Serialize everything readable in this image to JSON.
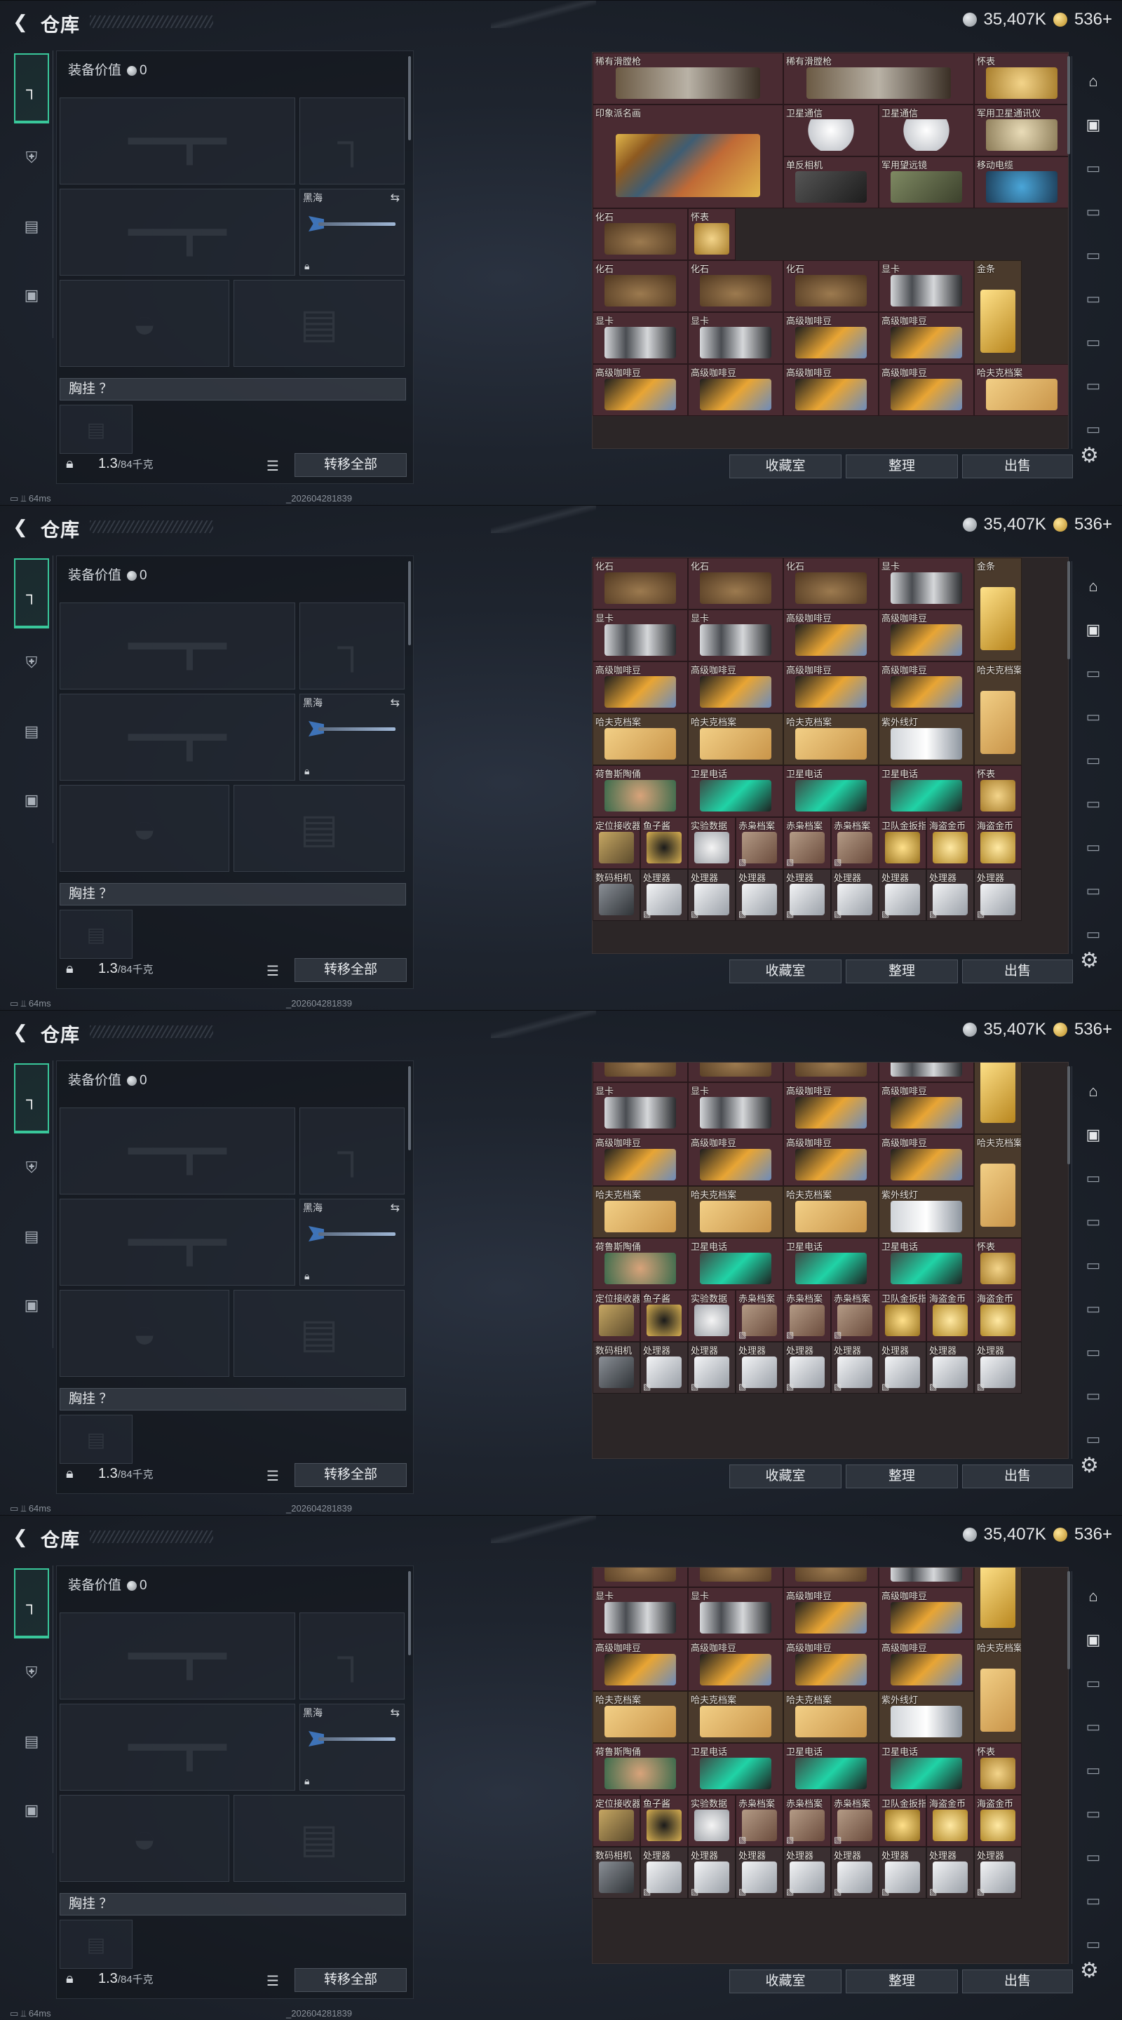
{
  "app": {
    "back_icon": "back-arrow-icon",
    "title": "仓库",
    "currency_silver": "35,407K",
    "currency_gold": "536+"
  },
  "left_tabs": [
    "weapon-icon",
    "helmet-icon",
    "vest-icon",
    "briefcase-icon"
  ],
  "equip": {
    "value_label": "装备价值",
    "value": "0",
    "melee_label": "黑海",
    "chest_label": "胸挂 ？",
    "weight_value": "1.3",
    "weight_max": "/84千克",
    "transfer_all": "转移全部"
  },
  "right_buttons": {
    "collection": "收藏室",
    "organize": "整理",
    "sell": "出售"
  },
  "status": {
    "ping": "64ms",
    "stamp": "_202604281839"
  },
  "right_side_icons": [
    "home-icon",
    "camera-icon",
    "tv-icon",
    "tv-icon",
    "tv-icon",
    "tv-icon",
    "tv-icon",
    "tv-icon",
    "tv-icon"
  ],
  "grid_view1": [
    {
      "c": 0,
      "r": 0,
      "w": 2,
      "h": 1,
      "name": "稀有滑膛枪",
      "art": "musket",
      "tone": "wine"
    },
    {
      "c": 2,
      "r": 0,
      "w": 2,
      "h": 1,
      "name": "稀有滑膛枪",
      "art": "musket",
      "tone": "wine"
    },
    {
      "c": 4,
      "r": 0,
      "w": 1,
      "h": 1,
      "name": "怀表",
      "art": "watch",
      "tone": "wine"
    },
    {
      "c": 0,
      "r": 1,
      "w": 2,
      "h": 2,
      "name": "印象派名画",
      "art": "painting",
      "tone": "wine"
    },
    {
      "c": 2,
      "r": 1,
      "w": 1,
      "h": 1,
      "name": "卫星通信",
      "art": "dish",
      "tone": "wine"
    },
    {
      "c": 3,
      "r": 1,
      "w": 1,
      "h": 1,
      "name": "卫星通信",
      "art": "dish",
      "tone": "wine"
    },
    {
      "c": 4,
      "r": 1,
      "w": 1,
      "h": 1,
      "name": "军用卫星通讯仪",
      "art": "milsat",
      "tone": "wine"
    },
    {
      "c": 2,
      "r": 2,
      "w": 1,
      "h": 1,
      "name": "单反相机",
      "art": "camera",
      "tone": "wine"
    },
    {
      "c": 3,
      "r": 2,
      "w": 1,
      "h": 1,
      "name": "军用望远镜",
      "art": "binoc",
      "tone": "wine"
    },
    {
      "c": 4,
      "r": 2,
      "w": 1,
      "h": 1,
      "name": "移动电缆",
      "art": "cable",
      "tone": "wine"
    },
    {
      "c": 0,
      "r": 3,
      "w": 1,
      "h": 1,
      "name": "化石",
      "art": "fossil",
      "tone": "wine"
    },
    {
      "c": 1,
      "r": 3,
      "w": 0.5,
      "h": 1,
      "name": "怀表",
      "art": "watch",
      "tone": "wine"
    },
    {
      "c": 0,
      "r": 4,
      "w": 1,
      "h": 1,
      "name": "化石",
      "art": "fossil",
      "tone": "wine"
    },
    {
      "c": 1,
      "r": 4,
      "w": 1,
      "h": 1,
      "name": "化石",
      "art": "fossil",
      "tone": "wine"
    },
    {
      "c": 2,
      "r": 4,
      "w": 1,
      "h": 1,
      "name": "化石",
      "art": "fossil",
      "tone": "wine"
    },
    {
      "c": 3,
      "r": 4,
      "w": 1,
      "h": 1,
      "name": "显卡",
      "art": "gpu",
      "tone": "wine"
    },
    {
      "c": 4,
      "r": 4,
      "w": 0.5,
      "h": 2,
      "name": "金条",
      "art": "gold",
      "tone": "brown"
    },
    {
      "c": 0,
      "r": 5,
      "w": 1,
      "h": 1,
      "name": "显卡",
      "art": "gpu",
      "tone": "wine"
    },
    {
      "c": 1,
      "r": 5,
      "w": 1,
      "h": 1,
      "name": "显卡",
      "art": "gpu",
      "tone": "wine"
    },
    {
      "c": 2,
      "r": 5,
      "w": 1,
      "h": 1,
      "name": "高级咖啡豆",
      "art": "coffee",
      "tone": "wine"
    },
    {
      "c": 3,
      "r": 5,
      "w": 1,
      "h": 1,
      "name": "高级咖啡豆",
      "art": "coffee",
      "tone": "wine"
    },
    {
      "c": 0,
      "r": 6,
      "w": 1,
      "h": 1,
      "name": "高级咖啡豆",
      "art": "coffee",
      "tone": "wine"
    },
    {
      "c": 1,
      "r": 6,
      "w": 1,
      "h": 1,
      "name": "高级咖啡豆",
      "art": "coffee",
      "tone": "wine"
    },
    {
      "c": 2,
      "r": 6,
      "w": 1,
      "h": 1,
      "name": "高级咖啡豆",
      "art": "coffee",
      "tone": "wine"
    },
    {
      "c": 3,
      "r": 6,
      "w": 1,
      "h": 1,
      "name": "高级咖啡豆",
      "art": "coffee",
      "tone": "wine"
    },
    {
      "c": 4,
      "r": 6,
      "w": 1,
      "h": 1,
      "name": "哈夫克档案",
      "art": "docs",
      "tone": "wine"
    }
  ],
  "grid_view2": [
    {
      "c": 0,
      "r": 0,
      "w": 1,
      "h": 1,
      "name": "化石",
      "art": "fossil",
      "tone": "wine"
    },
    {
      "c": 1,
      "r": 0,
      "w": 1,
      "h": 1,
      "name": "化石",
      "art": "fossil",
      "tone": "wine"
    },
    {
      "c": 2,
      "r": 0,
      "w": 1,
      "h": 1,
      "name": "化石",
      "art": "fossil",
      "tone": "wine"
    },
    {
      "c": 3,
      "r": 0,
      "w": 1,
      "h": 1,
      "name": "显卡",
      "art": "gpu",
      "tone": "wine"
    },
    {
      "c": 4,
      "r": 0,
      "w": 0.5,
      "h": 2,
      "name": "金条",
      "art": "gold",
      "tone": "brown"
    },
    {
      "c": 0,
      "r": 1,
      "w": 1,
      "h": 1,
      "name": "显卡",
      "art": "gpu",
      "tone": "wine"
    },
    {
      "c": 1,
      "r": 1,
      "w": 1,
      "h": 1,
      "name": "显卡",
      "art": "gpu",
      "tone": "wine"
    },
    {
      "c": 2,
      "r": 1,
      "w": 1,
      "h": 1,
      "name": "高级咖啡豆",
      "art": "coffee",
      "tone": "wine"
    },
    {
      "c": 3,
      "r": 1,
      "w": 1,
      "h": 1,
      "name": "高级咖啡豆",
      "art": "coffee",
      "tone": "wine"
    },
    {
      "c": 0,
      "r": 2,
      "w": 1,
      "h": 1,
      "name": "高级咖啡豆",
      "art": "coffee",
      "tone": "wine"
    },
    {
      "c": 1,
      "r": 2,
      "w": 1,
      "h": 1,
      "name": "高级咖啡豆",
      "art": "coffee",
      "tone": "wine"
    },
    {
      "c": 2,
      "r": 2,
      "w": 1,
      "h": 1,
      "name": "高级咖啡豆",
      "art": "coffee",
      "tone": "wine"
    },
    {
      "c": 3,
      "r": 2,
      "w": 1,
      "h": 1,
      "name": "高级咖啡豆",
      "art": "coffee",
      "tone": "wine"
    },
    {
      "c": 4,
      "r": 2,
      "w": 0.5,
      "h": 2,
      "name": "哈夫克档案",
      "art": "docs",
      "tone": "brown"
    },
    {
      "c": 0,
      "r": 3,
      "w": 1,
      "h": 1,
      "name": "哈夫克档案",
      "art": "docs",
      "tone": "brown"
    },
    {
      "c": 1,
      "r": 3,
      "w": 1,
      "h": 1,
      "name": "哈夫克档案",
      "art": "docs",
      "tone": "brown"
    },
    {
      "c": 2,
      "r": 3,
      "w": 1,
      "h": 1,
      "name": "哈夫克档案",
      "art": "docs",
      "tone": "brown"
    },
    {
      "c": 3,
      "r": 3,
      "w": 1,
      "h": 1,
      "name": "紫外线灯",
      "art": "uvlamp",
      "tone": "brown"
    },
    {
      "c": 0,
      "r": 4,
      "w": 1,
      "h": 1,
      "name": "荷鲁斯陶俑",
      "art": "statue",
      "tone": "wine"
    },
    {
      "c": 1,
      "r": 4,
      "w": 1,
      "h": 1,
      "name": "卫星电话",
      "art": "phone",
      "tone": "wine"
    },
    {
      "c": 2,
      "r": 4,
      "w": 1,
      "h": 1,
      "name": "卫星电话",
      "art": "phone",
      "tone": "wine"
    },
    {
      "c": 3,
      "r": 4,
      "w": 1,
      "h": 1,
      "name": "卫星电话",
      "art": "phone",
      "tone": "wine"
    },
    {
      "c": 4,
      "r": 4,
      "w": 0.5,
      "h": 1,
      "name": "怀表",
      "art": "watch",
      "tone": "wine"
    },
    {
      "c": 0,
      "r": 5,
      "w": 0.5,
      "h": 1,
      "name": "定位接收器",
      "art": "device",
      "tone": "wine"
    },
    {
      "c": 0.5,
      "r": 5,
      "w": 0.5,
      "h": 1,
      "name": "鱼子酱",
      "art": "caviar",
      "tone": "wine"
    },
    {
      "c": 1,
      "r": 5,
      "w": 0.5,
      "h": 1,
      "name": "实验数据",
      "art": "disk",
      "tone": "wine"
    },
    {
      "c": 1.5,
      "r": 5,
      "w": 0.5,
      "h": 1,
      "name": "赤枭档案",
      "art": "owlfile",
      "tone": "wine",
      "flag": true
    },
    {
      "c": 2,
      "r": 5,
      "w": 0.5,
      "h": 1,
      "name": "赤枭档案",
      "art": "owlfile",
      "tone": "wine",
      "flag": true
    },
    {
      "c": 2.5,
      "r": 5,
      "w": 0.5,
      "h": 1,
      "name": "赤枭档案",
      "art": "owlfile",
      "tone": "wine",
      "flag": true
    },
    {
      "c": 3,
      "r": 5,
      "w": 0.5,
      "h": 1,
      "name": "卫队金扳指",
      "art": "ring",
      "tone": "wine"
    },
    {
      "c": 3.5,
      "r": 5,
      "w": 0.5,
      "h": 1,
      "name": "海盗金币",
      "art": "coin",
      "tone": "wine"
    },
    {
      "c": 4,
      "r": 5,
      "w": 0.5,
      "h": 1,
      "name": "海盗金币",
      "art": "coin",
      "tone": "wine"
    },
    {
      "c": 0,
      "r": 6,
      "w": 0.5,
      "h": 1,
      "name": "数码相机",
      "art": "dcam",
      "tone": "dark"
    },
    {
      "c": 0.5,
      "r": 6,
      "w": 0.5,
      "h": 1,
      "name": "处理器",
      "art": "cpu",
      "tone": "dark",
      "flag": true
    },
    {
      "c": 1,
      "r": 6,
      "w": 0.5,
      "h": 1,
      "name": "处理器",
      "art": "cpu",
      "tone": "dark",
      "flag": true
    },
    {
      "c": 1.5,
      "r": 6,
      "w": 0.5,
      "h": 1,
      "name": "处理器",
      "art": "cpu",
      "tone": "dark",
      "flag": true
    },
    {
      "c": 2,
      "r": 6,
      "w": 0.5,
      "h": 1,
      "name": "处理器",
      "art": "cpu",
      "tone": "dark",
      "flag": true
    },
    {
      "c": 2.5,
      "r": 6,
      "w": 0.5,
      "h": 1,
      "name": "处理器",
      "art": "cpu",
      "tone": "dark",
      "flag": true
    },
    {
      "c": 3,
      "r": 6,
      "w": 0.5,
      "h": 1,
      "name": "处理器",
      "art": "cpu",
      "tone": "dark",
      "flag": true
    },
    {
      "c": 3.5,
      "r": 6,
      "w": 0.5,
      "h": 1,
      "name": "处理器",
      "art": "cpu",
      "tone": "dark",
      "flag": true
    },
    {
      "c": 4,
      "r": 6,
      "w": 0.5,
      "h": 1,
      "name": "处理器",
      "art": "cpu",
      "tone": "dark",
      "flag": true
    }
  ]
}
